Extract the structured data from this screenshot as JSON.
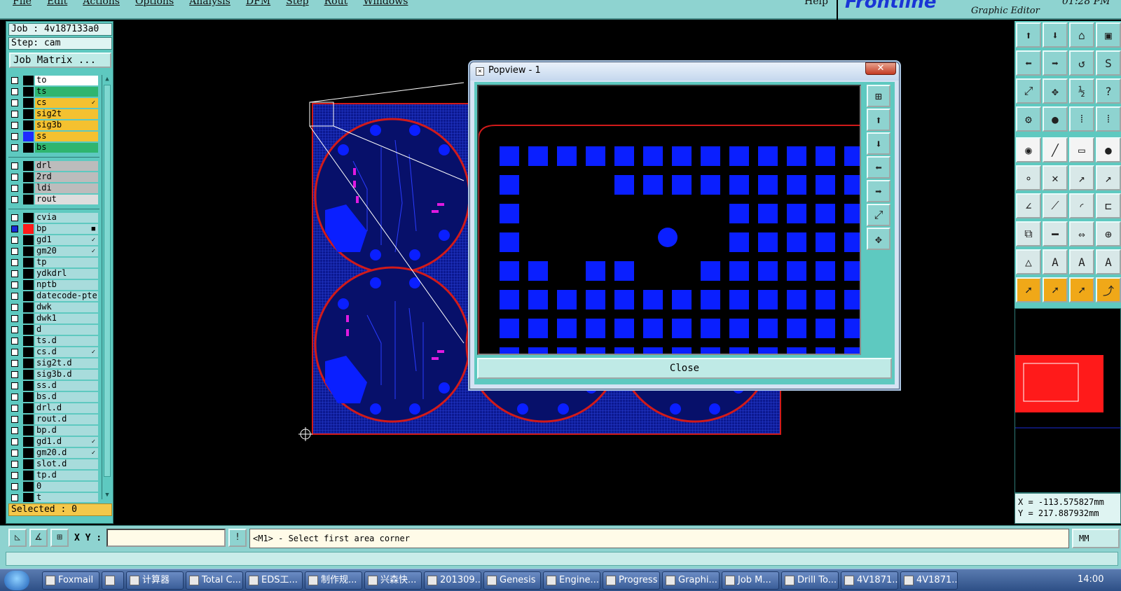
{
  "menubar": {
    "items": [
      "File",
      "Edit",
      "Actions",
      "Options",
      "Analysis",
      "DFM",
      "Step",
      "Rout",
      "Windows"
    ],
    "help": "Help"
  },
  "brand": {
    "logo": "Frontline",
    "subtitle": "Graphic Editor",
    "clock": "01:28 PM"
  },
  "job": {
    "job_label": "Job : 4v187133a0",
    "step_label": "Step: cam",
    "matrix_button": "Job Matrix ..."
  },
  "layers": {
    "group1": [
      {
        "name": "to",
        "color": "#ffffff"
      },
      {
        "name": "ts",
        "color": "#2fb56f"
      },
      {
        "name": "cs",
        "color": "#f4c130",
        "mark": "✓"
      },
      {
        "name": "sig2t",
        "color": "#f4c130"
      },
      {
        "name": "sig3b",
        "color": "#f4c130"
      },
      {
        "name": "ss",
        "color": "#f4c130",
        "swatch": "#1f2bff"
      },
      {
        "name": "bs",
        "color": "#2fb56f"
      }
    ],
    "group2": [
      {
        "name": "drl",
        "color": "#bcbcbc"
      },
      {
        "name": "2rd",
        "color": "#bcbcbc"
      },
      {
        "name": "ldi",
        "color": "#bcbcbc"
      },
      {
        "name": "rout",
        "color": "#dddddd"
      }
    ],
    "group3": [
      {
        "name": "cvia",
        "color": "#a8dcdc"
      },
      {
        "name": "bp",
        "color": "#a8dcdc",
        "swatch": "#ff1a1a",
        "mark": "■",
        "selected": true
      },
      {
        "name": "gd1",
        "color": "#a8dcdc",
        "mark": "✓"
      },
      {
        "name": "gm20",
        "color": "#a8dcdc",
        "mark": "✓"
      },
      {
        "name": "tp",
        "color": "#a8dcdc"
      },
      {
        "name": "ydkdrl",
        "color": "#a8dcdc"
      },
      {
        "name": "nptb",
        "color": "#a8dcdc"
      },
      {
        "name": "datecode-pte",
        "color": "#a8dcdc"
      },
      {
        "name": "dwk",
        "color": "#a8dcdc"
      },
      {
        "name": "dwk1",
        "color": "#a8dcdc"
      },
      {
        "name": "d",
        "color": "#a8dcdc"
      },
      {
        "name": "ts.d",
        "color": "#a8dcdc"
      },
      {
        "name": "cs.d",
        "color": "#a8dcdc",
        "mark": "✓"
      },
      {
        "name": "sig2t.d",
        "color": "#a8dcdc"
      },
      {
        "name": "sig3b.d",
        "color": "#a8dcdc"
      },
      {
        "name": "ss.d",
        "color": "#a8dcdc"
      },
      {
        "name": "bs.d",
        "color": "#a8dcdc"
      },
      {
        "name": "drl.d",
        "color": "#a8dcdc"
      },
      {
        "name": "rout.d",
        "color": "#a8dcdc"
      },
      {
        "name": "bp.d",
        "color": "#a8dcdc"
      },
      {
        "name": "gd1.d",
        "color": "#a8dcdc",
        "mark": "✓"
      },
      {
        "name": "gm20.d",
        "color": "#a8dcdc",
        "mark": "✓"
      },
      {
        "name": "slot.d",
        "color": "#a8dcdc"
      },
      {
        "name": "tp.d",
        "color": "#a8dcdc"
      },
      {
        "name": "0",
        "color": "#a8dcdc"
      },
      {
        "name": "t",
        "color": "#a8dcdc"
      }
    ],
    "selected_label": "Selected : 0"
  },
  "popview": {
    "title": "Popview - 1",
    "close_x": "✕",
    "close_button": "Close"
  },
  "coords": {
    "x": "X = -113.575827mm",
    "y": "Y = 217.887932mm"
  },
  "bottombar": {
    "xy_label": "X Y :",
    "xy_value": "",
    "excl": "!",
    "prompt": "<M1> - Select first area corner",
    "units": "MM"
  },
  "taskbar": {
    "items": [
      "Foxmail",
      "",
      "计算器",
      "Total C...",
      "EDS工...",
      "制作规...",
      "兴森快...",
      "201309...",
      "Genesis",
      "Engine...",
      "Progress",
      "Graphi...",
      "Job M...",
      "Drill To...",
      "4V1871...",
      "4V1871..."
    ],
    "time": "14:00"
  },
  "colors": {
    "panel": "#5ec9c0",
    "menubar": "#8ed3d0",
    "pad_blue": "#0a1fff",
    "outline_red": "#d11a1a"
  }
}
